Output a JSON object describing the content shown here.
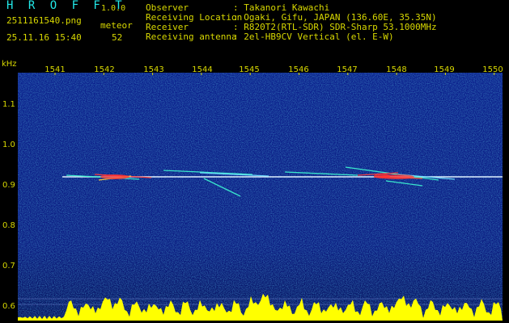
{
  "app": {
    "logo": "H R O F F T",
    "version": "1.0.0",
    "filename": "2511161540.png",
    "datetime": "25.11.16 15:40",
    "meteor_label": "meteor",
    "meteor_count": "52"
  },
  "info": [
    {
      "key": "Observer",
      "value": ": Takanori Kawachi"
    },
    {
      "key": "Receiving Location",
      "value": ": Ogaki, Gifu, JAPAN (136.60E, 35.35N)"
    },
    {
      "key": "Receiver",
      "value": ": R820T2(RTL-SDR) SDR-Sharp 53.1000MHz"
    },
    {
      "key": "Receiving antenna",
      "value": ": 2el-HB9CV Vertical (el. E-W)"
    }
  ],
  "axes": {
    "y_unit": "kHz",
    "x_ticks": [
      "1541",
      "1542",
      "1543",
      "1544",
      "1545",
      "1546",
      "1547",
      "1548",
      "1549",
      "1550"
    ],
    "y_ticks": [
      "1.1",
      "1.0",
      "0.9",
      "0.8",
      "0.7",
      "0.6"
    ]
  },
  "colors": {
    "label": "#d8d800",
    "logo": "#22e8e8",
    "background_noise": "#0a1a88",
    "carrier": "#e0f0ff",
    "echo_hot": "#ff3030",
    "spectrum_fill": "#ffff00"
  }
}
